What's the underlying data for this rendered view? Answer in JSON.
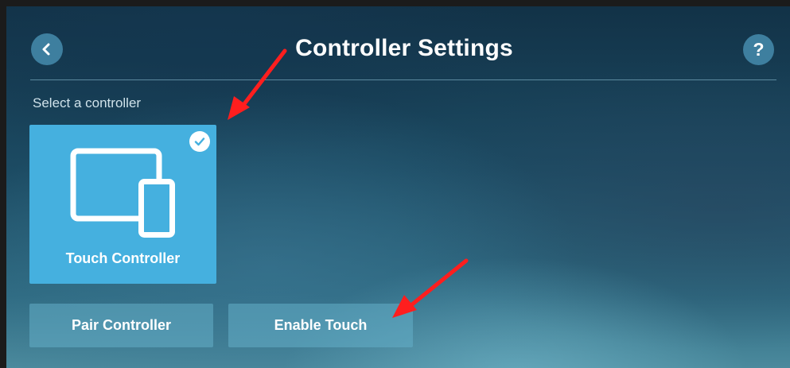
{
  "header": {
    "title": "Controller Settings",
    "help_label": "?"
  },
  "section": {
    "label": "Select a controller"
  },
  "controllers": [
    {
      "label": "Touch Controller",
      "selected": true,
      "icon": "tablet-phone-icon"
    }
  ],
  "actions": {
    "pair_label": "Pair Controller",
    "enable_touch_label": "Enable Touch"
  },
  "colors": {
    "card_accent": "#45b0df",
    "button_bg": "#3e7f9f",
    "annotation_arrow": "#ff1e1e"
  }
}
